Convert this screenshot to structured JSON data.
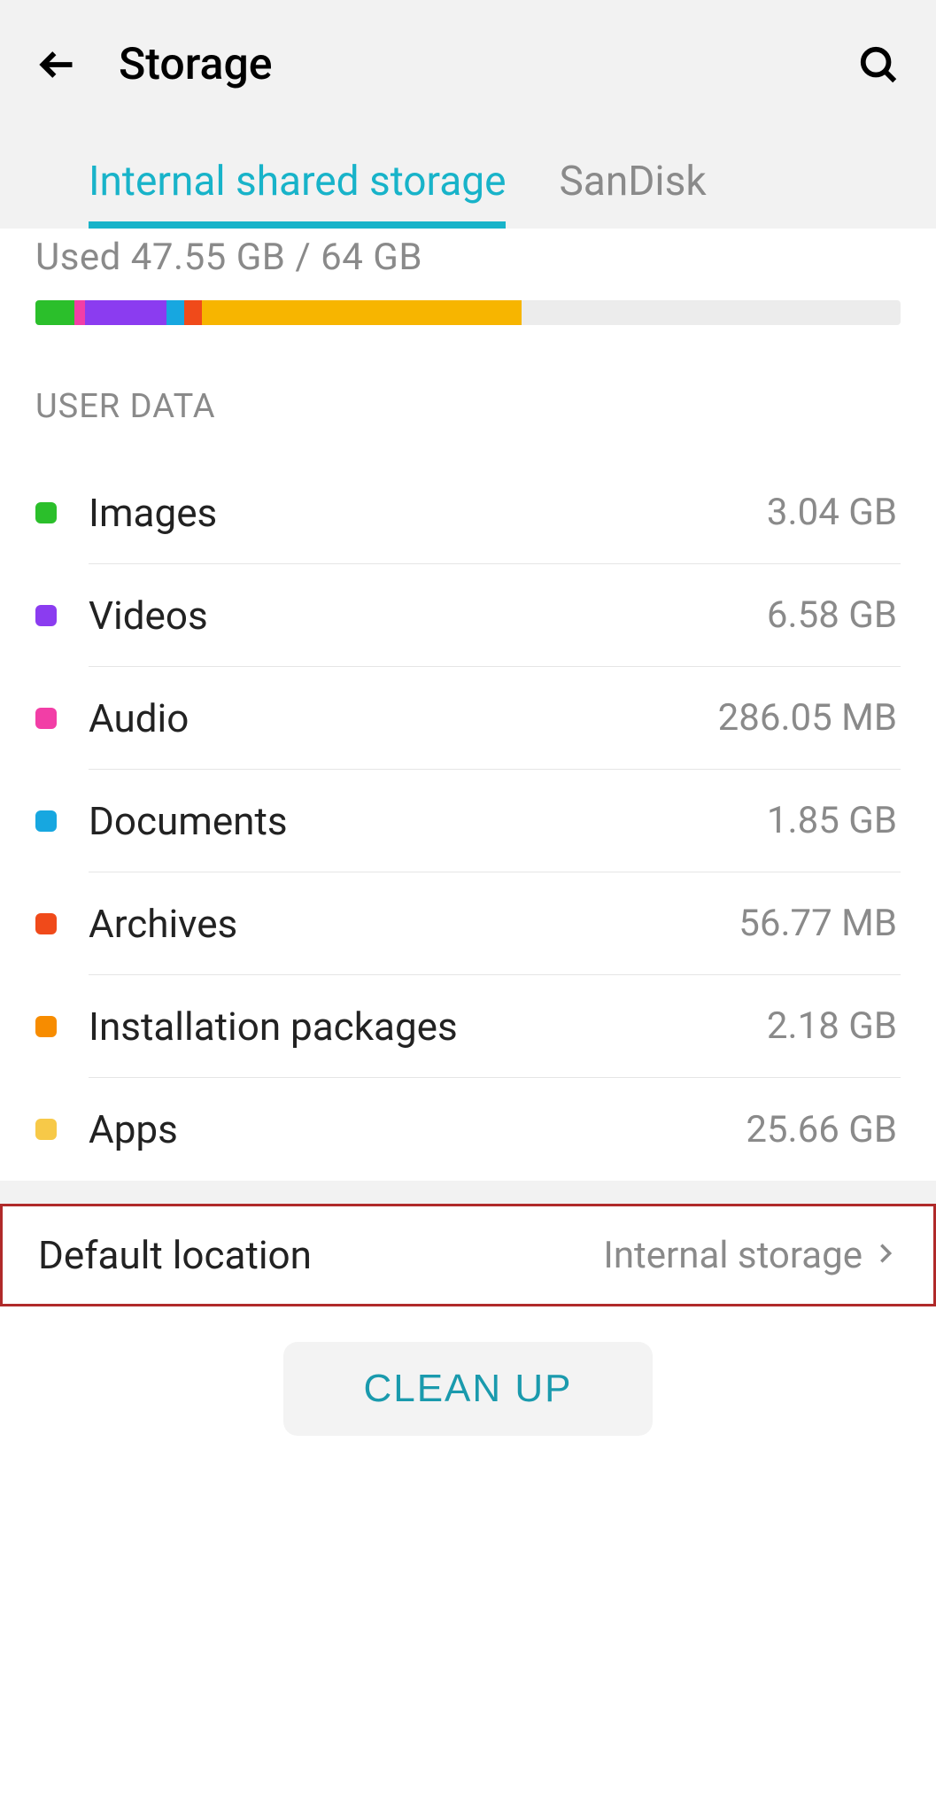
{
  "header": {
    "title": "Storage"
  },
  "tabs": [
    {
      "label": "Internal shared storage",
      "active": true
    },
    {
      "label": "SanDisk",
      "active": false
    }
  ],
  "usage": {
    "text": "Used 47.55 GB / 64 GB",
    "segments": [
      {
        "color": "#2bbf2b",
        "pct": 4.5
      },
      {
        "color": "#f23ea6",
        "pct": 1.2
      },
      {
        "color": "#8b3cf0",
        "pct": 9.5
      },
      {
        "color": "#17a7e0",
        "pct": 2.0
      },
      {
        "color": "#f04a1a",
        "pct": 2.0
      },
      {
        "color": "#f7b500",
        "pct": 37.0
      }
    ]
  },
  "section_header": "USER DATA",
  "items": [
    {
      "label": "Images",
      "size": "3.04 GB",
      "color": "#2bbf2b"
    },
    {
      "label": "Videos",
      "size": "6.58 GB",
      "color": "#8b3cf0"
    },
    {
      "label": "Audio",
      "size": "286.05 MB",
      "color": "#f23ea6"
    },
    {
      "label": "Documents",
      "size": "1.85 GB",
      "color": "#17a7e0"
    },
    {
      "label": "Archives",
      "size": "56.77 MB",
      "color": "#f04a1a"
    },
    {
      "label": "Installation packages",
      "size": "2.18 GB",
      "color": "#f78c00"
    },
    {
      "label": "Apps",
      "size": "25.66 GB",
      "color": "#f7c948"
    }
  ],
  "default_location": {
    "label": "Default location",
    "value": "Internal storage"
  },
  "footer": {
    "cleanup_label": "CLEAN UP"
  }
}
